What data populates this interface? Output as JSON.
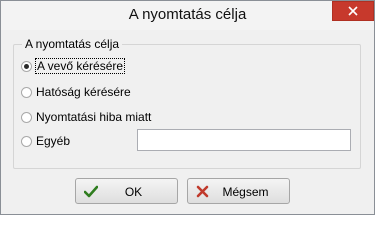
{
  "window": {
    "title": "A nyomtatás célja"
  },
  "group": {
    "title": "A nyomtatás célja",
    "options": [
      {
        "label": "A vevő kérésére",
        "selected": true
      },
      {
        "label": "Hatóság kérésére",
        "selected": false
      },
      {
        "label": "Nyomtatási hiba miatt",
        "selected": false
      },
      {
        "label": "Egyéb",
        "selected": false
      }
    ],
    "other_value": ""
  },
  "buttons": {
    "ok_label": "OK",
    "cancel_label": "Mégsem"
  },
  "colors": {
    "close_button": "#c7392c",
    "ok_icon": "#2f7d1f",
    "cancel_icon": "#c0392b"
  },
  "icons": {
    "ok": "checkmark-icon",
    "cancel": "x-icon",
    "close": "close-icon"
  }
}
